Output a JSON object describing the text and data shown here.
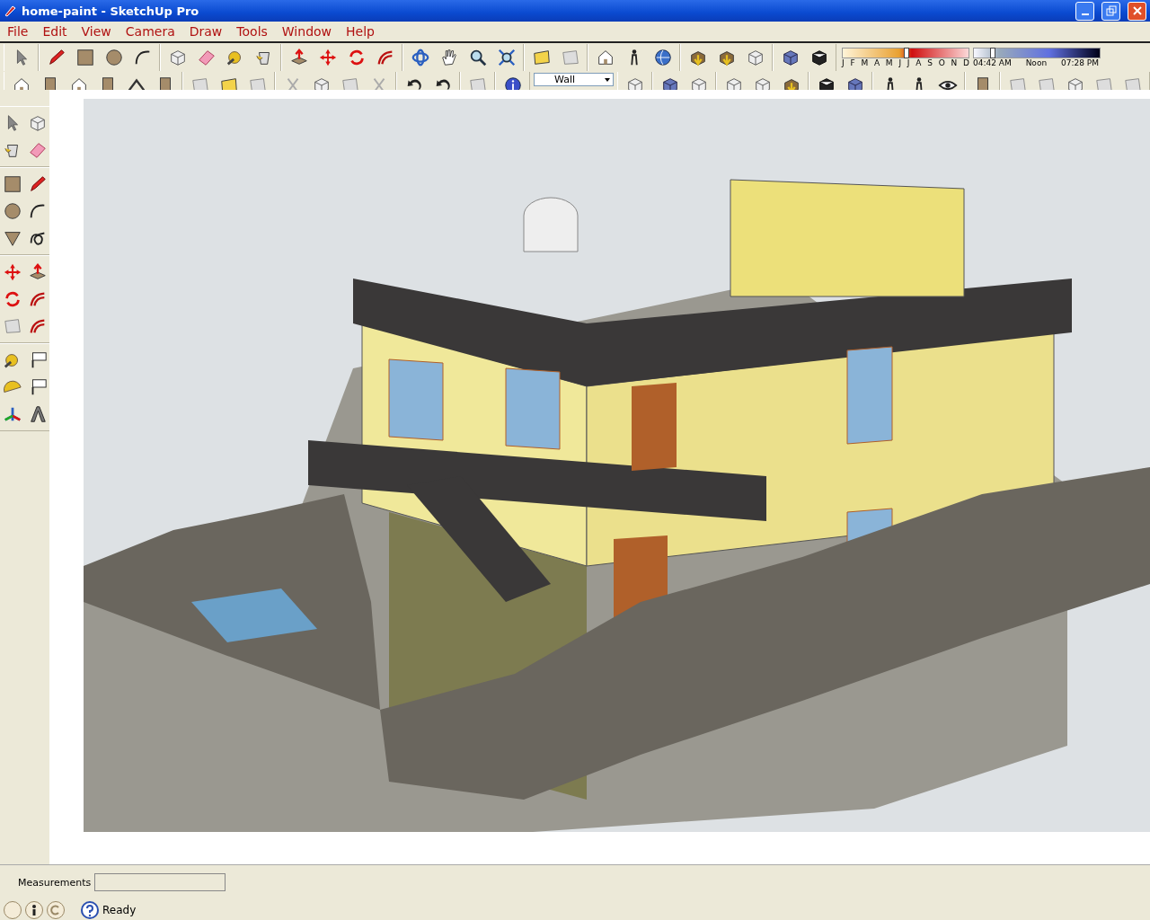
{
  "window": {
    "title": "home-paint - SketchUp Pro"
  },
  "menu": [
    "File",
    "Edit",
    "View",
    "Camera",
    "Draw",
    "Tools",
    "Window",
    "Help"
  ],
  "layer_dropdown": {
    "value": "Wall"
  },
  "shadow_settings": {
    "months": [
      "J",
      "F",
      "M",
      "A",
      "M",
      "J",
      "J",
      "A",
      "S",
      "O",
      "N",
      "D"
    ],
    "month_slider": {
      "level": 0.5
    },
    "time_labels": [
      "04:42 AM",
      "Noon",
      "07:28 PM"
    ],
    "time_slider": {
      "level": 0.13
    }
  },
  "measurements": {
    "label": "Measurements"
  },
  "status_bar": {
    "text": "Ready"
  }
}
